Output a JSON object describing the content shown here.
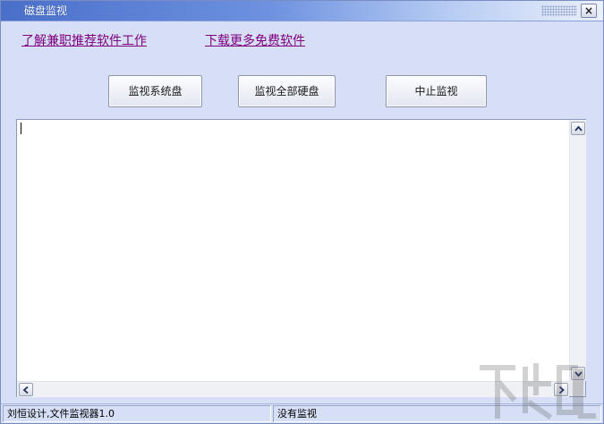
{
  "window": {
    "title": "磁盘监视",
    "close_glyph": "×"
  },
  "links": {
    "learn_more": "了解兼职推荐软件工作",
    "download_more": "下载更多免费软件"
  },
  "buttons": {
    "monitor_system_disk": "监视系统盘",
    "monitor_all_disks": "监视全部硬盘",
    "stop_monitoring": "中止监视"
  },
  "log": {
    "content": ""
  },
  "status": {
    "author_info": "刘恒设计,文件监视器1.0",
    "monitor_state": "没有监视"
  },
  "colors": {
    "link": "#800080",
    "window_bg": "#d6dff5",
    "title_gradient_start": "#4a6fc9"
  },
  "icons": {
    "close": "close-icon",
    "scroll_up": "arrow-up-icon",
    "scroll_down": "arrow-down-icon",
    "scroll_left": "arrow-left-icon",
    "scroll_right": "arrow-right-icon"
  }
}
